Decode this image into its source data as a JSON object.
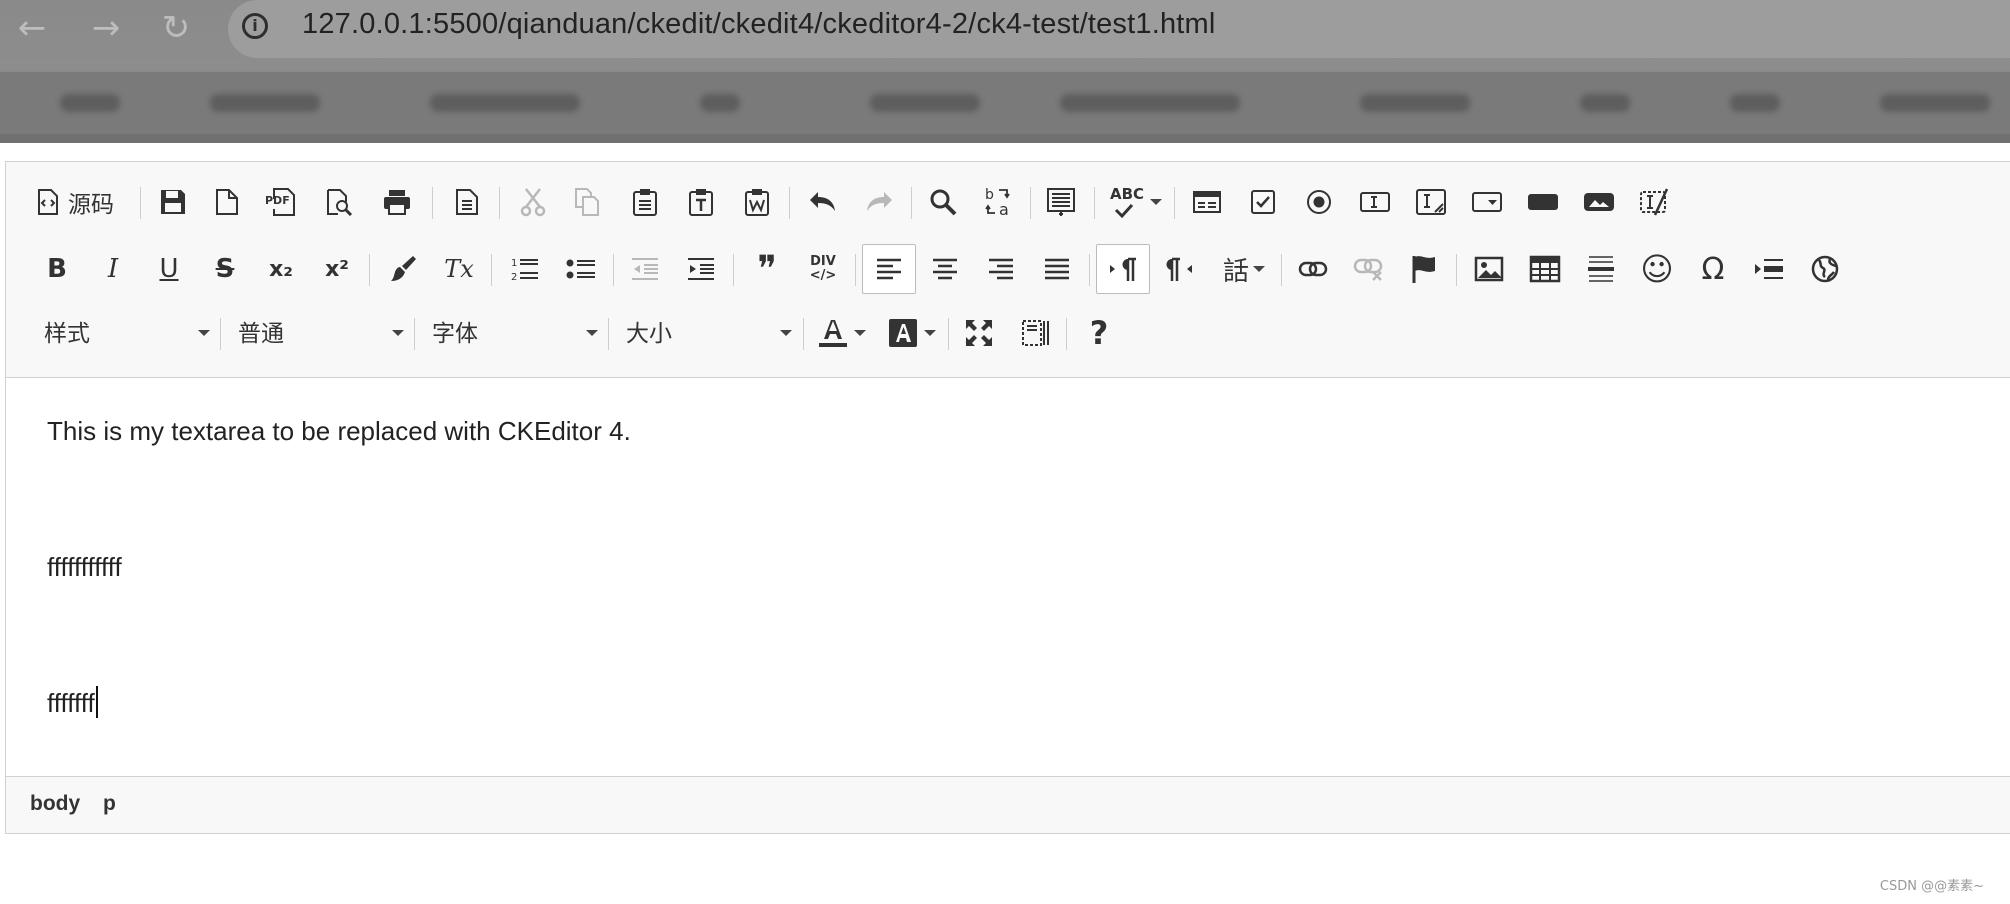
{
  "browser": {
    "url": "127.0.0.1:5500/qianduan/ckedit/ckedit4/ckeditor4-2/ck4-test/test1.html",
    "back_glyph": "←",
    "forward_glyph": "→",
    "reload_glyph": "↻",
    "info_glyph": "i"
  },
  "toolbar": {
    "source_label": "源码",
    "blockquote_glyph": "❞",
    "div_label_top": "DIV",
    "div_label_bottom": "</>",
    "language_glyph": "話",
    "omega_glyph": "Ω",
    "smiley_glyph": "☺",
    "help_glyph": "?",
    "bold_glyph": "B",
    "italic_glyph": "I",
    "underline_glyph": "U",
    "strike_glyph": "S",
    "subscript_glyph": "x₂",
    "superscript_glyph": "x²",
    "removeformat_glyph": "Tx",
    "pdf_label": "PDF",
    "spell_label": "ABC",
    "find_glyph": "🔍",
    "combos": {
      "styles": "样式",
      "format": "普通",
      "font": "字体",
      "size": "大小"
    }
  },
  "content": {
    "paragraphs": [
      "This is my textarea to be replaced with CKEditor 4.",
      "fffffffffff",
      "fffffff"
    ]
  },
  "statusbar": {
    "path": [
      "body",
      "p"
    ]
  },
  "watermark": "CSDN @@素素~",
  "colors": {
    "toolbar_bg": "#f8f8f8",
    "border": "#d1d1d1",
    "icon": "#333333",
    "icon_disabled": "#b8b8b8"
  }
}
